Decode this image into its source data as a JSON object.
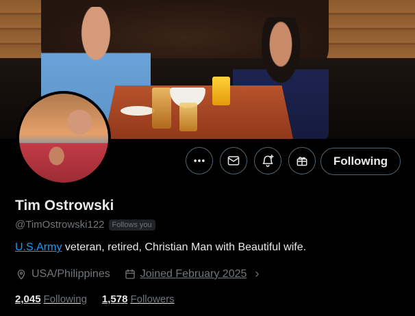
{
  "profile": {
    "name": "Tim Ostrowski",
    "handle": "@TimOstrowski122",
    "follows_you_badge": "Follows you",
    "bio_link": "U.S.Army",
    "bio_text": " veteran, retired, Christian Man with Beautiful wife.",
    "location": "USA/Philippines",
    "joined": "Joined February 2025",
    "following_count": "2,045",
    "following_label": "Following",
    "followers_count": "1,578",
    "followers_label": "Followers"
  },
  "actions": {
    "more_icon": "more-horizontal-icon",
    "message_icon": "envelope-icon",
    "notify_icon": "bell-plus-icon",
    "gift_icon": "gift-icon",
    "following_button": "Following"
  },
  "colors": {
    "background": "#000000",
    "text": "#e7e9ea",
    "muted": "#71767b",
    "link": "#1d9bf0",
    "border": "#536471"
  }
}
